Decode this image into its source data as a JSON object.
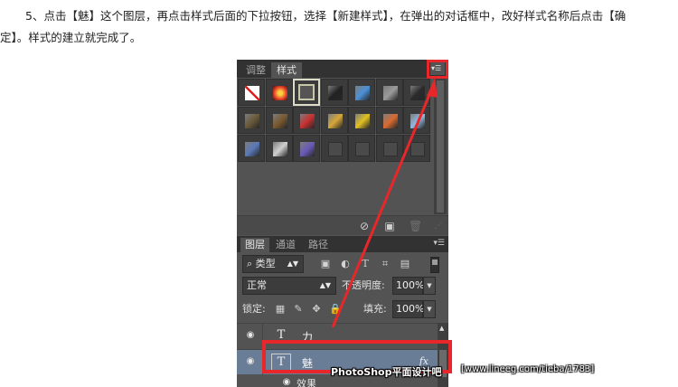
{
  "instruction": {
    "line1": "5、点击【魅】这个图层，再点击样式后面的下拉按钮，选择【新建样式】，在弹出的对话框中，改好样式名称后点击【确",
    "line2": "定】。样式的建立就完成了。"
  },
  "styles_panel": {
    "tabs": [
      "调整",
      "样式"
    ],
    "active_tab": "样式",
    "menu_icon": "panel-menu-icon",
    "swatches": [
      {
        "icon": "no-style-swatch",
        "color": "#ffffff"
      },
      {
        "icon": "glow-swatch",
        "color": "#e8402a"
      },
      {
        "icon": "frame-swatch",
        "color": "#c8c8a8"
      },
      {
        "icon": "dark-button-swatch",
        "color": "#222222"
      },
      {
        "icon": "blue-glass-swatch",
        "color": "#4a90d8"
      },
      {
        "icon": "gray-swatch",
        "color": "#9a9a9a"
      },
      {
        "icon": "black-gradient-swatch",
        "color": "#2a2a2a"
      },
      {
        "icon": "bronze-swatch",
        "color": "#6a5a3a"
      },
      {
        "icon": "brown-swatch",
        "color": "#7a5a30"
      },
      {
        "icon": "red-stripe-swatch",
        "color": "#c83030"
      },
      {
        "icon": "multicolor-swatch",
        "color": "#d8a838"
      },
      {
        "icon": "gold-swatch",
        "color": "#e0c020"
      },
      {
        "icon": "sunset-swatch",
        "color": "#d86a30"
      },
      {
        "icon": "sky-swatch",
        "color": "#90b8e0"
      },
      {
        "icon": "landscape-swatch",
        "color": "#5a7ab8"
      },
      {
        "icon": "pattern-swatch",
        "color": "#d0d0d0"
      },
      {
        "icon": "purple-swatch",
        "color": "#6a5ab8"
      },
      {
        "icon": "empty-swatch",
        "color": "#3b3b3b"
      },
      {
        "icon": "empty-swatch",
        "color": "#3b3b3b"
      },
      {
        "icon": "empty-swatch",
        "color": "#3b3b3b"
      },
      {
        "icon": "empty-swatch",
        "color": "#3b3b3b"
      }
    ],
    "footer_icons": [
      "clear-style-icon",
      "new-style-icon",
      "delete-style-icon"
    ]
  },
  "layers_panel": {
    "tabs": [
      "图层",
      "通道",
      "路径"
    ],
    "active_tab": "图层",
    "filter_kind": "类型",
    "filter_icons": [
      "pixel-filter-icon",
      "adjustment-filter-icon",
      "type-filter-icon",
      "shape-filter-icon",
      "smart-object-filter-icon"
    ],
    "blend_mode": "正常",
    "opacity_label": "不透明度:",
    "opacity_value": "100%",
    "lock_label": "锁定:",
    "fill_label": "填充:",
    "fill_value": "100%",
    "lock_icons": [
      "lock-transparent-icon",
      "lock-paint-icon",
      "lock-position-icon",
      "lock-all-icon"
    ],
    "layers": [
      {
        "name": "力",
        "type_glyph": "T",
        "selected": false
      },
      {
        "name": "魅",
        "type_glyph": "T",
        "selected": true,
        "fx": "fx"
      }
    ],
    "effect_label": "效果"
  },
  "watermark": {
    "text1": "PhotoShop平面设计吧",
    "text2": "[www.lineeg.com/tieba/1783]"
  },
  "colors": {
    "panel": "#535353",
    "tabbar": "#323232",
    "highlight": "#e8272a",
    "selected_layer": "#6a7d97"
  }
}
